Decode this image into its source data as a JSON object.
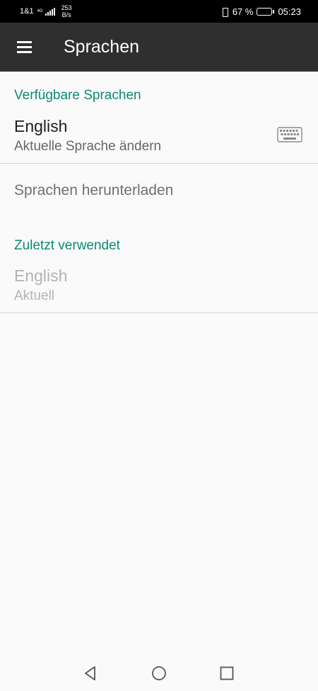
{
  "status_bar": {
    "carrier": "1&1",
    "network_type": "4G",
    "net_speed_value": "253",
    "net_speed_unit": "B/s",
    "battery_percent": "67 %",
    "battery_level": 0.67,
    "time": "05:23",
    "icons": [
      "signal-icon",
      "vibrate-icon",
      "battery-icon"
    ]
  },
  "app_bar": {
    "title": "Sprachen",
    "menu_icon": "hamburger-menu-icon"
  },
  "available": {
    "header": "Verfügbare Sprachen",
    "language": "English",
    "subtitle": "Aktuelle Sprache ändern",
    "icon": "keyboard-icon"
  },
  "download": {
    "label": "Sprachen herunterladen"
  },
  "recent": {
    "header": "Zuletzt verwendet",
    "language": "English",
    "subtitle": "Aktuell"
  },
  "nav_bar": {
    "icons": [
      "back-icon",
      "home-icon",
      "recents-icon"
    ]
  },
  "colors": {
    "accent": "#0b8a73",
    "app_bar": "#2f2f2f",
    "status_bar": "#000000",
    "background": "#fafafa"
  }
}
